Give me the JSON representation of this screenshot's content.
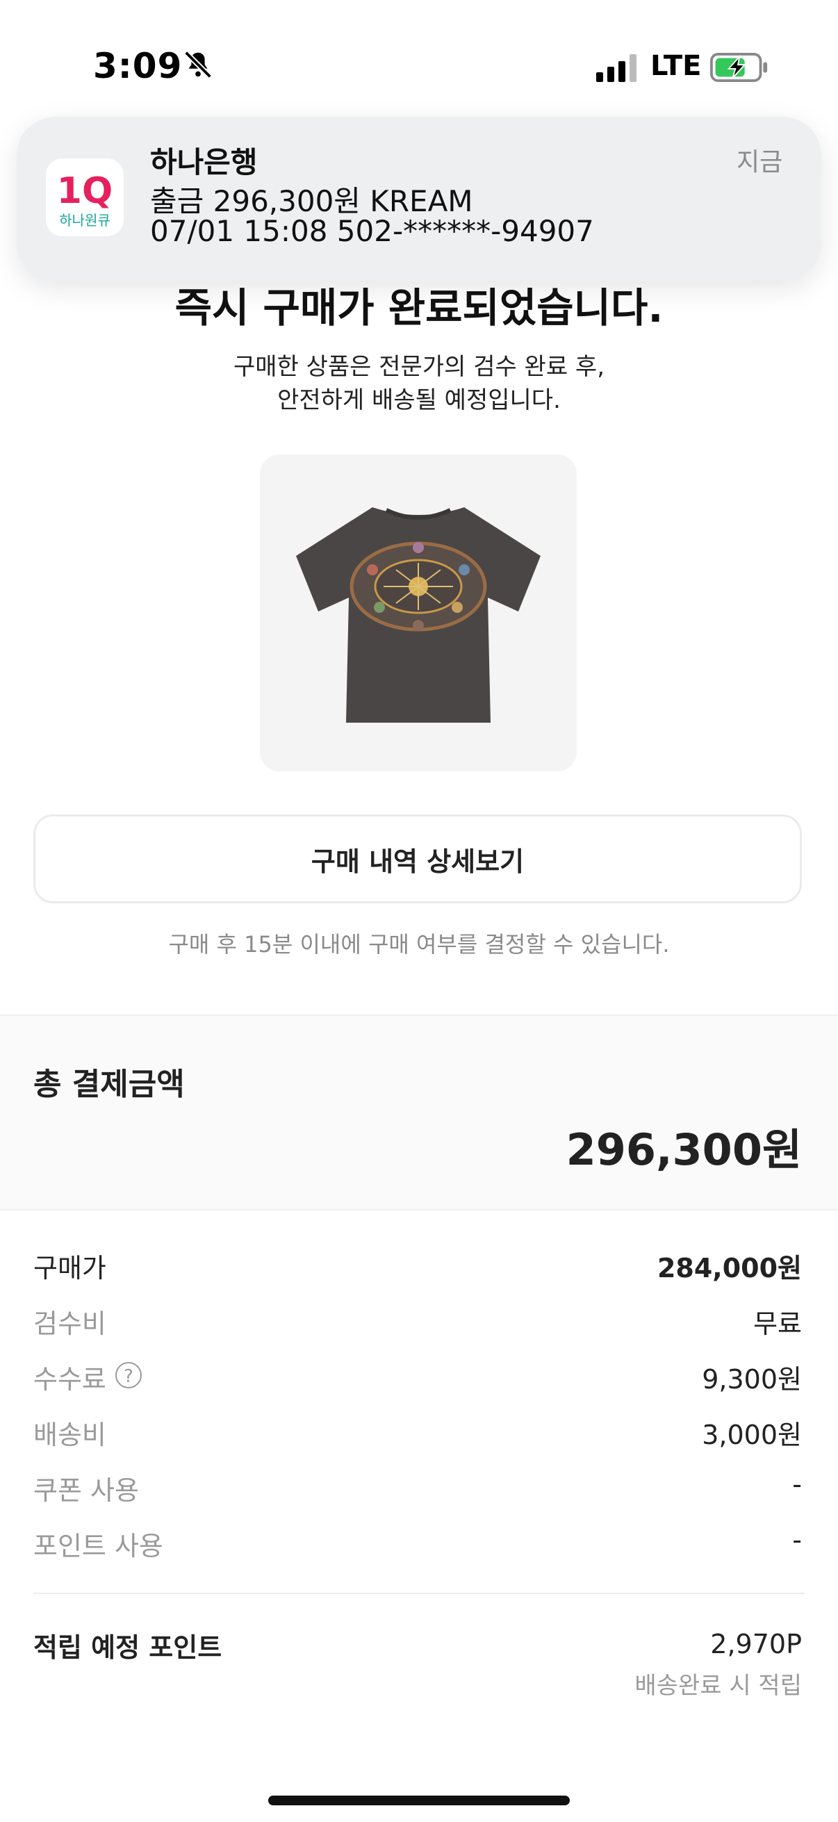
{
  "status_bar": {
    "time": "3:09",
    "network": "LTE",
    "icons": [
      "bell-slash-icon",
      "signal-icon",
      "battery-charging-icon"
    ]
  },
  "notification": {
    "app_name": "하나은행",
    "time": "지금",
    "line1": "출금 296,300원 KREAM",
    "line2": "07/01 15:08 502-******-94907",
    "icon_label": "하나원큐",
    "icon_logo": "1Q",
    "accent_color": "#e6205e",
    "teal_color": "#17a69a"
  },
  "main": {
    "headline": "즉시 구매가 완료되었습니다.",
    "subtext_line1": "구매한 상품은 전문가의 검수 완료 후,",
    "subtext_line2": "안전하게 배송될 예정입니다.",
    "product_image": "t-shirt-product-image",
    "detail_button": "구매 내역 상세보기",
    "note": "구매 후 15분 이내에 구매 여부를 결정할 수 있습니다."
  },
  "total": {
    "label": "총 결제금액",
    "value": "296,300원"
  },
  "breakdown": [
    {
      "label": "구매가",
      "value": "284,000원"
    },
    {
      "label": "검수비",
      "value": "무료"
    },
    {
      "label": "수수료",
      "value": "9,300원"
    },
    {
      "label": "배송비",
      "value": "3,000원"
    },
    {
      "label": "쿠폰 사용",
      "value": "-"
    },
    {
      "label": "포인트 사용",
      "value": "-"
    }
  ],
  "points": {
    "label": "적립 예정 포인트",
    "value": "2,970P",
    "note": "배송완료 시 적립"
  },
  "help_icon_char": "?"
}
